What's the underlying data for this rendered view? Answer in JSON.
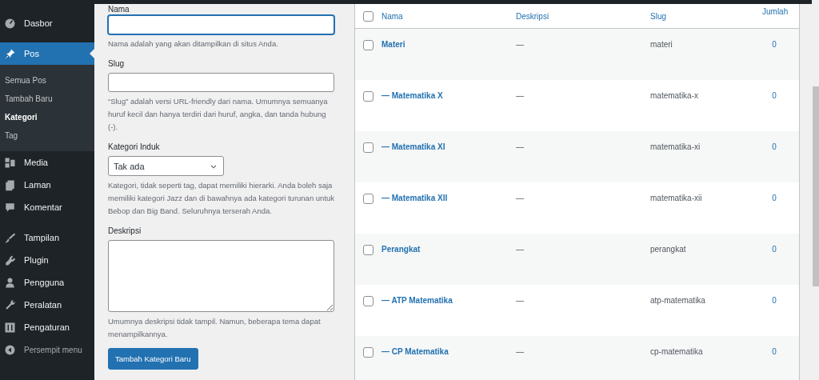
{
  "sidebar": {
    "items": [
      {
        "label": "Dasbor",
        "selected": false
      },
      {
        "label": "Pos",
        "selected": true,
        "children": [
          {
            "label": "Semua Pos",
            "selected": false
          },
          {
            "label": "Tambah Baru",
            "selected": false
          },
          {
            "label": "Kategori",
            "selected": true
          },
          {
            "label": "Tag",
            "selected": false
          }
        ]
      },
      {
        "label": "Media",
        "selected": false
      },
      {
        "label": "Laman",
        "selected": false
      },
      {
        "label": "Komentar",
        "selected": false
      },
      {
        "label": "Tampilan",
        "selected": false
      },
      {
        "label": "Plugin",
        "selected": false
      },
      {
        "label": "Pengguna",
        "selected": false
      },
      {
        "label": "Peralatan",
        "selected": false
      },
      {
        "label": "Pengaturan",
        "selected": false
      }
    ],
    "collapse": {
      "label": "Persempit menu"
    }
  },
  "form": {
    "fields": [
      {
        "kind": "text",
        "label": "Nama",
        "help": "Nama adalah yang akan ditampilkan di situs Anda.",
        "focused": true
      },
      {
        "kind": "text",
        "label": "Slug",
        "help": "“Slug” adalah versi URL-friendly dari nama. Umumnya semuanya huruf kecil dan hanya terdiri dari huruf, angka, dan tanda hubung (-).",
        "focused": false
      },
      {
        "kind": "select",
        "label": "Kategori Induk",
        "value": "Tak ada",
        "help": "Kategori, tidak seperti tag, dapat memiliki hierarki. Anda boleh saja memiliki kategori Jazz dan di bawahnya ada kategori turunan untuk Bebop dan Big Band. Seluruhnya terserah Anda."
      },
      {
        "kind": "textarea",
        "label": "Deskripsi",
        "help": "Umumnya deskripsi tidak tampil. Namun, beberapa tema dapat menampilkannya."
      }
    ],
    "submit": "Tambah Kategori Baru"
  },
  "table": {
    "select_all_checked": false,
    "columns": [
      "Nama",
      "Deskripsi",
      "Slug",
      "Jumlah"
    ],
    "rows": [
      {
        "name": "Materi",
        "description": "—",
        "slug": "materi",
        "count": "0",
        "checked": false
      },
      {
        "name": "— Matematika X",
        "description": "—",
        "slug": "matematika-x",
        "count": "0",
        "checked": false
      },
      {
        "name": "— Matematika XI",
        "description": "—",
        "slug": "matematika-xi",
        "count": "0",
        "checked": false
      },
      {
        "name": "— Matematika XII",
        "description": "—",
        "slug": "matematika-xii",
        "count": "0",
        "checked": false
      },
      {
        "name": "Perangkat",
        "description": "—",
        "slug": "perangkat",
        "count": "0",
        "checked": false
      },
      {
        "name": "— ATP Matematika",
        "description": "—",
        "slug": "atp-matematika",
        "count": "0",
        "checked": false
      },
      {
        "name": "— CP Matematika",
        "description": "—",
        "slug": "cp-matematika",
        "count": "0",
        "checked": false
      }
    ]
  }
}
